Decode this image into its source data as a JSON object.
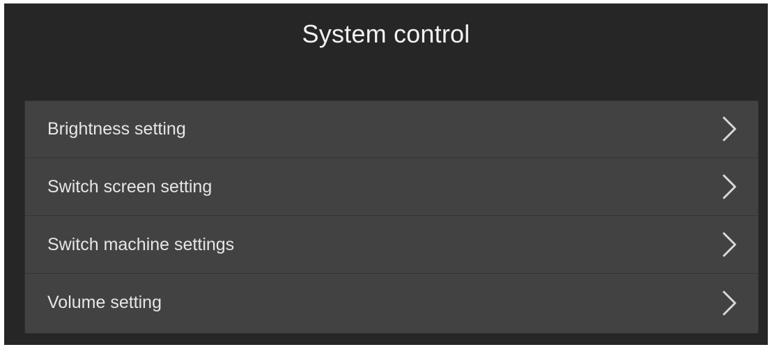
{
  "header": {
    "title": "System control"
  },
  "menu": {
    "items": [
      {
        "label": "Brightness setting",
        "icon": "chevron-right-icon"
      },
      {
        "label": "Switch screen setting",
        "icon": "chevron-right-icon"
      },
      {
        "label": "Switch machine settings",
        "icon": "chevron-right-icon"
      },
      {
        "label": "Volume setting",
        "icon": "chevron-right-icon"
      }
    ]
  },
  "colors": {
    "background": "#262626",
    "panel": "#424242",
    "text": "#e6e6e6",
    "title": "#f2f2f2"
  }
}
